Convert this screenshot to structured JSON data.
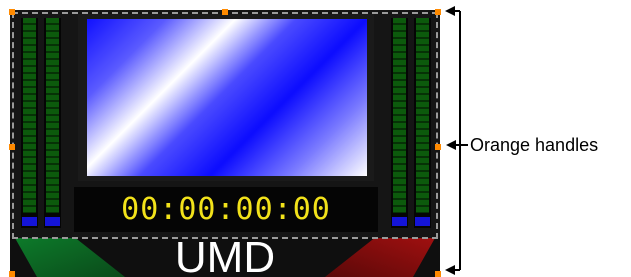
{
  "timecode": "00:00:00:00",
  "umd_label": "UMD",
  "annotation": "Orange handles",
  "colors": {
    "handle": "#ff8a00",
    "timecode": "#f2e21a",
    "meter_green": "#0c5a0c",
    "meter_clip": "#1414d8",
    "tally_left": "#0d7a2a",
    "tally_right": "#a01010"
  },
  "icons": {
    "arrow": "left-arrowhead",
    "handle": "orange-square-handle"
  }
}
